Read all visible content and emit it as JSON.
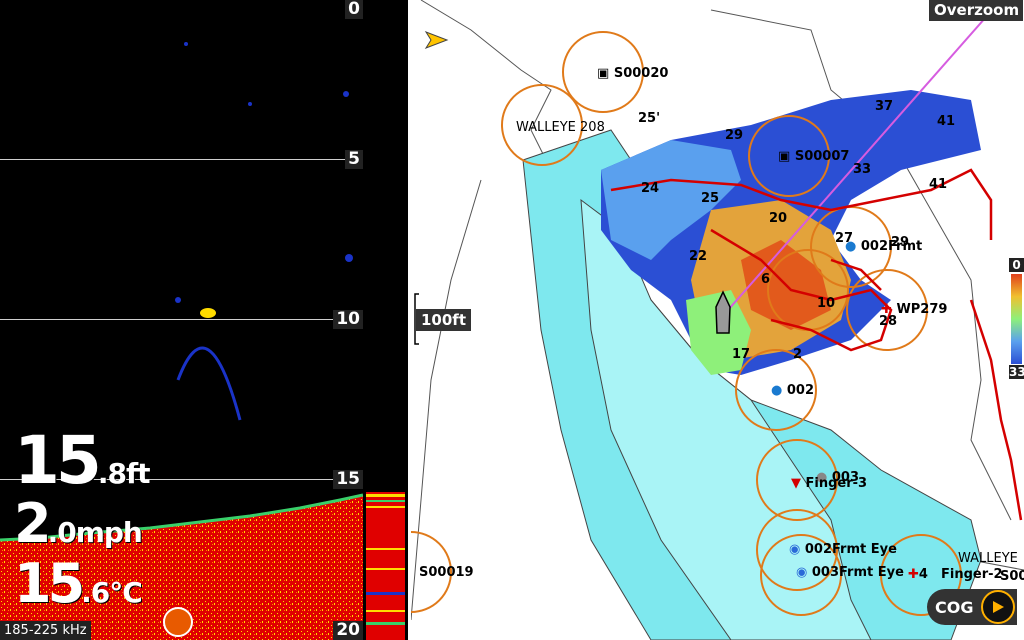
{
  "sonar": {
    "depth_ticks": [
      "0",
      "5",
      "10",
      "15",
      "20"
    ],
    "depth": {
      "value": "15",
      "decimal": ".8",
      "unit": "ft"
    },
    "speed": {
      "value": "2",
      "decimal": ".0",
      "unit": "mph"
    },
    "temp": {
      "value": "15",
      "decimal": ".6",
      "unit": "°C"
    },
    "frequency": "185-225 kHz",
    "colors": {
      "bottom": "#e00000",
      "returns": "#ffdc00",
      "fish": "#1a33c8"
    }
  },
  "chart": {
    "scale": "100ft",
    "overzoom": "Overzoom",
    "cog": "COG",
    "depth_legend": {
      "min": "0",
      "max": "33"
    },
    "depth_labels": [
      "25'",
      "29",
      "37",
      "41",
      "33",
      "41",
      "24",
      "25",
      "20",
      "22",
      "6",
      "10",
      "28",
      "17",
      "2",
      "27",
      "29"
    ],
    "waypoints": {
      "s00020": "S00020",
      "walleye1": "WALLEYE",
      "s208": "208",
      "s0000": "S0000",
      "s0000_suffix": "7",
      "frmt002": "002Frmt",
      "wp279": "WP279",
      "w002": "002",
      "w003": "003",
      "finger3": "Finger-3",
      "frmt002eye": "002Frmt Eye",
      "frmt003eye": "003Frmt Eye",
      "c4": "4",
      "finger2": "Finger-2",
      "walleye2": "WALLEYE",
      "s00": "S00",
      "s00019": "S00019"
    },
    "colors": {
      "shallow_water": "#7ee8ee",
      "range_ring": "#e07a1a",
      "track": "#d40000",
      "heading_line": "#d65ce0"
    }
  }
}
